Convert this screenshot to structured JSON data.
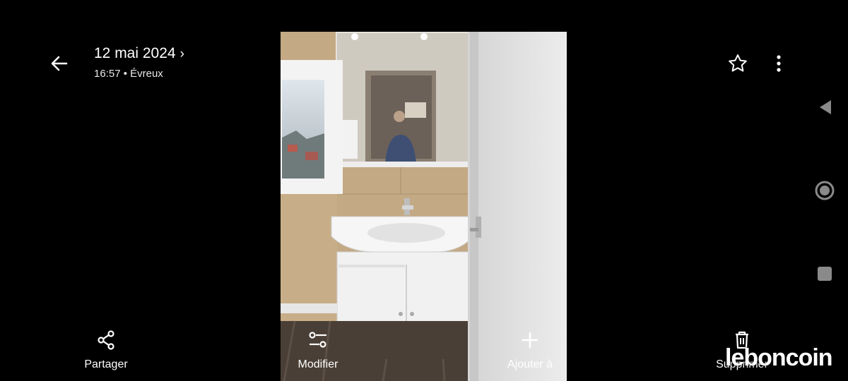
{
  "header": {
    "date": "12 mai 2024",
    "time_location": "16:57 • Évreux"
  },
  "icons": {
    "back": "arrow-left-icon",
    "favorite": "star-outline-icon",
    "more": "more-vertical-icon",
    "share": "share-icon",
    "edit": "sliders-icon",
    "add": "plus-icon",
    "delete": "trash-icon"
  },
  "photo": {
    "description_colors": {
      "wall_tile": "#c9b08a",
      "cabinet": "#f1f1f1",
      "door": "#e9e9e9",
      "floor": "#4a3f36"
    }
  },
  "actions": [
    {
      "label": "Partager"
    },
    {
      "label": "Modifier"
    },
    {
      "label": "Ajouter à"
    },
    {
      "label": "Supprimer"
    }
  ],
  "watermark": {
    "text": "leboncoin"
  },
  "system_nav": {
    "back": "triangle-back-icon",
    "home": "circle-home-icon",
    "recents": "square-recents-icon"
  }
}
